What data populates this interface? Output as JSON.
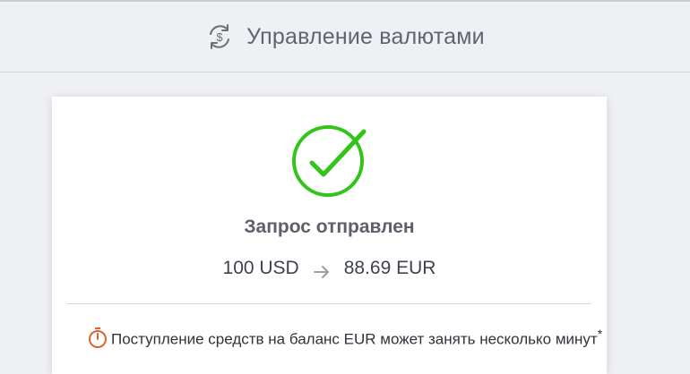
{
  "header": {
    "title": "Управление валютами",
    "icon": "currency-exchange-icon"
  },
  "status": {
    "icon": "check-circle-icon",
    "title": "Запрос отправлен",
    "success_color": "#33c41a"
  },
  "conversion": {
    "from": "100 USD",
    "to": "88.69 EUR",
    "arrow_icon": "arrow-right-icon"
  },
  "notice": {
    "icon": "stopwatch-icon",
    "icon_color": "#e0632b",
    "text": "Поступление средств на баланс EUR может занять несколько минут",
    "footnote_mark": "*"
  }
}
